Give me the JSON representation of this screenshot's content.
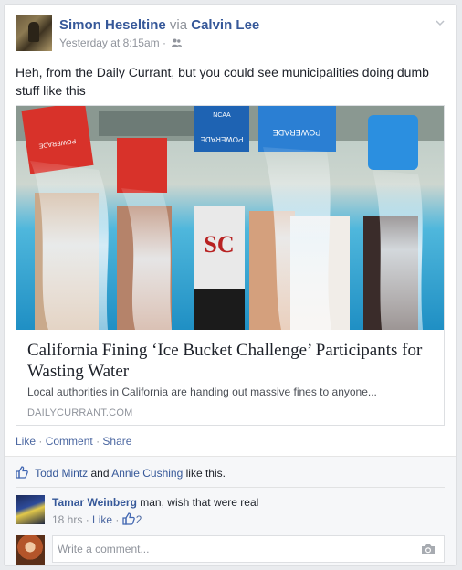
{
  "post": {
    "author": "Simon Heseltine",
    "via_word": "via",
    "via_name": "Calvin Lee",
    "timestamp": "Yesterday at 8:15am",
    "separator": "·",
    "text": "Heh, from the Daily Currant, but you could see municipalities doing dumb stuff like this"
  },
  "link": {
    "title": "California Fining ‘Ice Bucket Challenge’ Participants for Wasting Water",
    "description": "Local authorities in California are handing out massive fines to anyone...",
    "domain": "DAILYCURRANT.COM",
    "image_bucket_texts": [
      "POWERADE",
      "POWERADE",
      "POWERADE",
      "NCAA",
      "SC"
    ]
  },
  "actions": {
    "like": "Like",
    "comment": "Comment",
    "share": "Share",
    "sep": "·"
  },
  "likes": {
    "user1": "Todd Mintz",
    "and": "and",
    "user2": "Annie Cushing",
    "suffix": "like this."
  },
  "comment": {
    "author": "Tamar Weinberg",
    "text": "man, wish that were real",
    "time": "18 hrs",
    "sep": "·",
    "like": "Like",
    "like_count": "2"
  },
  "reply": {
    "placeholder": "Write a comment..."
  },
  "colors": {
    "link_blue": "#365899",
    "meta_grey": "#90949c",
    "feedback_bg": "#f6f7f9"
  },
  "icons": [
    "friends-icon",
    "chevron-down-icon",
    "thumbs-up-icon",
    "camera-icon"
  ]
}
